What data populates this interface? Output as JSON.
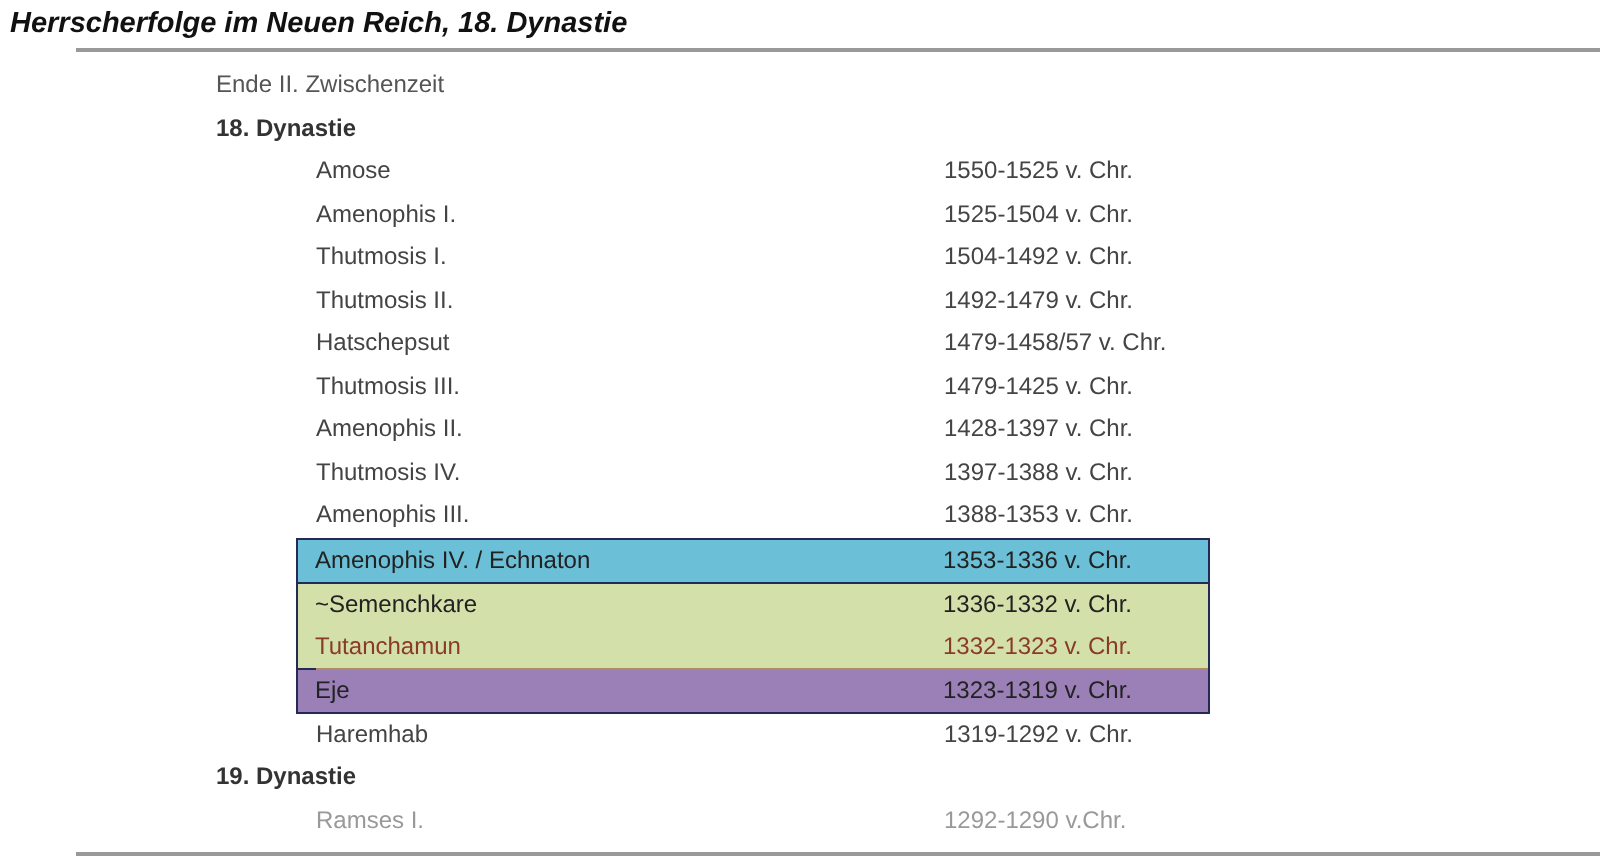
{
  "title": "Herrscherfolge im Neuen Reich, 18. Dynastie",
  "entries": [
    {
      "kind": "heading",
      "label": "Ende II. Zwischenzeit",
      "bold": false
    },
    {
      "kind": "heading",
      "label": "18. Dynastie",
      "bold": true
    },
    {
      "kind": "ruler",
      "name": "Amose",
      "reign": "1550-1525 v. Chr.",
      "linked": false,
      "muted": false
    },
    {
      "kind": "ruler",
      "name": "Amenophis I.",
      "reign": "1525-1504 v. Chr.",
      "linked": false,
      "muted": false
    },
    {
      "kind": "ruler",
      "name": "Thutmosis I.",
      "reign": "1504-1492 v. Chr.",
      "linked": false,
      "muted": false
    },
    {
      "kind": "ruler",
      "name": "Thutmosis II.",
      "reign": "1492-1479 v. Chr.",
      "linked": false,
      "muted": false
    },
    {
      "kind": "ruler",
      "name": "Hatschepsut",
      "reign": "1479-1458/57 v. Chr.",
      "linked": false,
      "muted": false
    },
    {
      "kind": "ruler",
      "name": "Thutmosis III.",
      "reign": "1479-1425 v. Chr.",
      "linked": false,
      "muted": false
    },
    {
      "kind": "ruler",
      "name": "Amenophis II.",
      "reign": "1428-1397 v. Chr.",
      "linked": false,
      "muted": false
    },
    {
      "kind": "ruler",
      "name": "Thutmosis IV.",
      "reign": "1397-1388 v. Chr.",
      "linked": false,
      "muted": false
    },
    {
      "kind": "ruler",
      "name": "Amenophis III.",
      "reign": "1388-1353 v. Chr.",
      "linked": false,
      "muted": false
    },
    {
      "kind": "group",
      "color": "#6bbfd6",
      "rows": [
        {
          "name": "Amenophis IV. / Echnaton",
          "reign": "1353-1336 v. Chr.",
          "linked": false,
          "muted": false
        }
      ]
    },
    {
      "kind": "group",
      "color": "#d3e0a9",
      "rows": [
        {
          "name": "~Semenchkare",
          "reign": "1336-1332 v. Chr.",
          "linked": false,
          "muted": false
        },
        {
          "name": "Tutanchamun",
          "reign": "1332-1323 v. Chr.",
          "linked": true,
          "muted": false
        }
      ]
    },
    {
      "kind": "group",
      "color": "#9b80b8",
      "rows": [
        {
          "name": "Eje",
          "reign": "1323-1319 v. Chr.",
          "linked": false,
          "muted": false
        }
      ]
    },
    {
      "kind": "ruler",
      "name": "Haremhab",
      "reign": "1319-1292 v. Chr.",
      "linked": false,
      "muted": false
    },
    {
      "kind": "heading",
      "label": "19. Dynastie",
      "bold": true
    },
    {
      "kind": "ruler",
      "name": "Ramses I.",
      "reign": "1292-1290 v.Chr.",
      "linked": false,
      "muted": true
    }
  ]
}
